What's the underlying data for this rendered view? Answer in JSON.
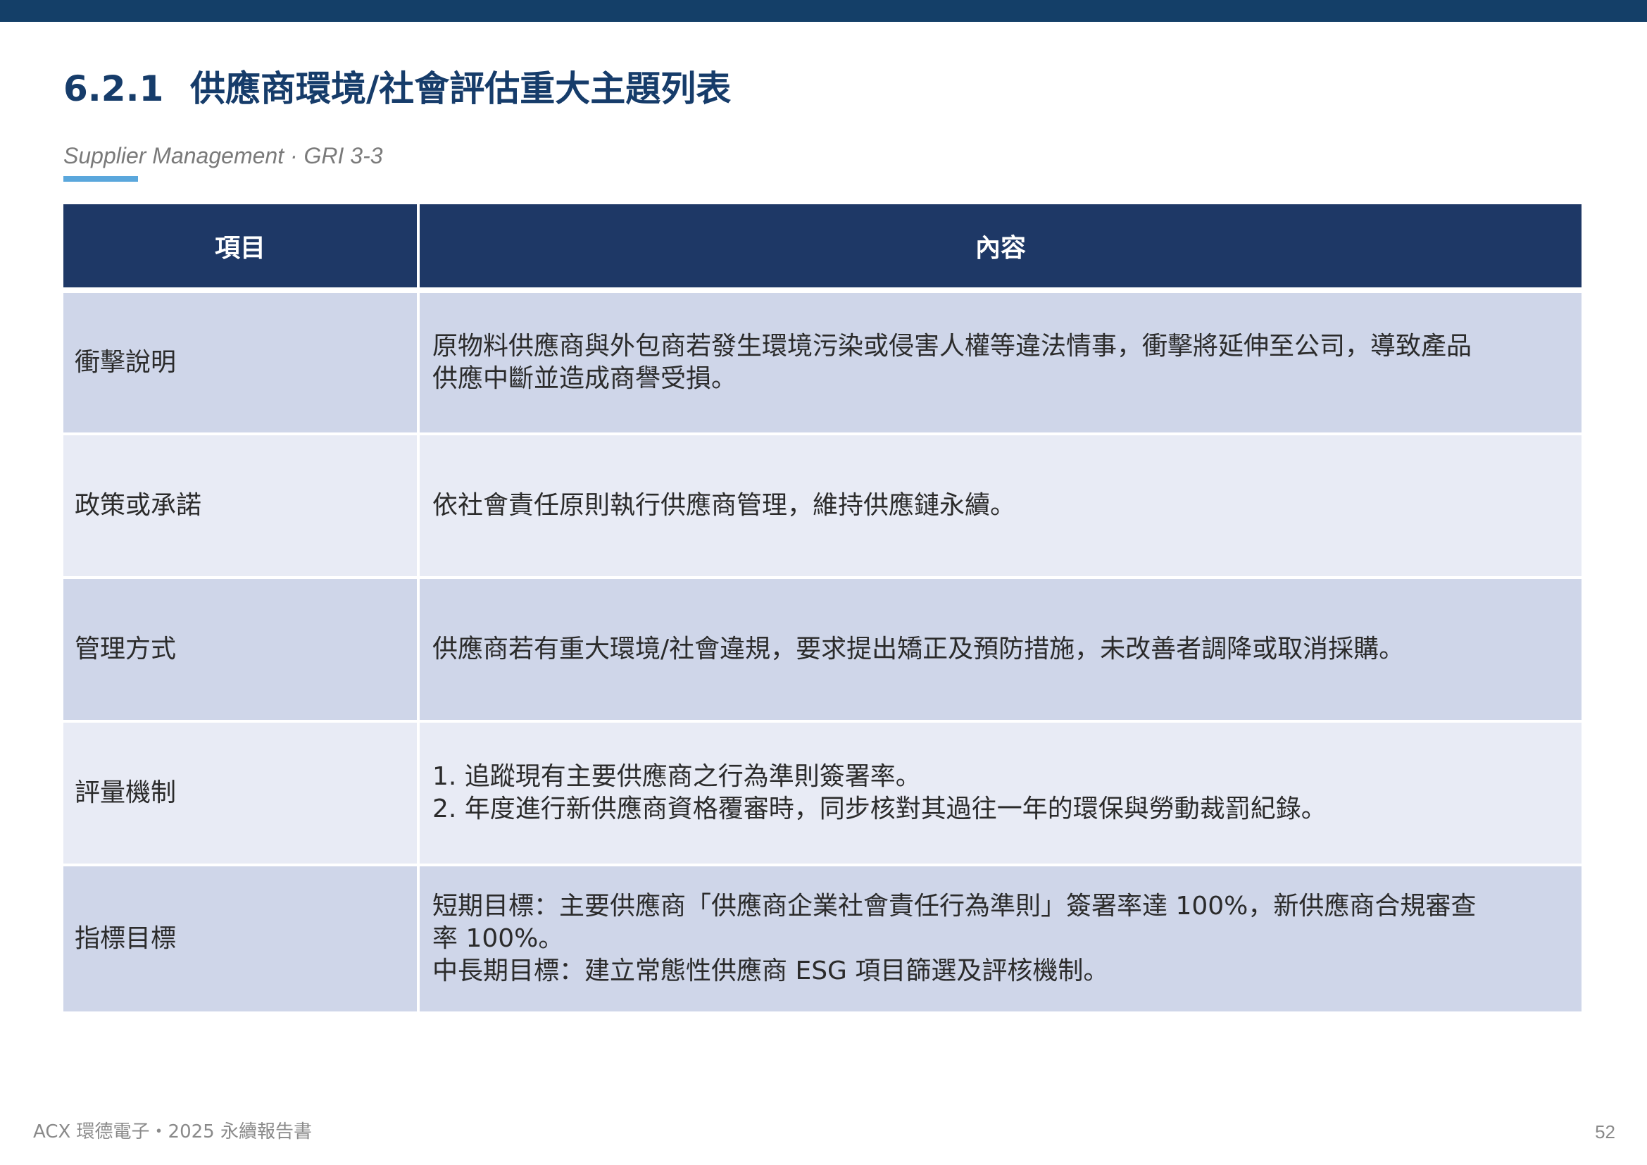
{
  "header": {
    "section_number": "6.2.1",
    "section_title": "供應商環境/社會評估重大主題列表",
    "subtitle": "Supplier Management · GRI 3-3"
  },
  "table": {
    "columns": [
      "項目",
      "內容"
    ],
    "rows": [
      {
        "item": "衝擊說明",
        "lines": [
          "原物料供應商與外包商若發生環境污染或侵害人權等違法情事，衝擊將延伸至公司，導致產品",
          "供應中斷並造成商譽受損。"
        ]
      },
      {
        "item": "政策或承諾",
        "lines": [
          "依社會責任原則執行供應商管理，維持供應鏈永續。"
        ]
      },
      {
        "item": "管理方式",
        "lines": [
          "供應商若有重大環境/社會違規，要求提出矯正及預防措施，未改善者調降或取消採購。"
        ]
      },
      {
        "item": "評量機制",
        "lines": [
          "1. 追蹤現有主要供應商之行為準則簽署率。",
          "2. 年度進行新供應商資格覆審時，同步核對其過往一年的環保與勞動裁罰紀錄。"
        ]
      },
      {
        "item": "指標目標",
        "lines": [
          "短期目標：主要供應商「供應商企業社會責任行為準則」簽署率達 100%，新供應商合規審查",
          "率 100%。",
          "中長期目標：建立常態性供應商 ESG 項目篩選及評核機制。"
        ]
      }
    ]
  },
  "footer": {
    "report_name": "ACX 環德電子・2025 永續報告書",
    "page_number": "52"
  },
  "colors": {
    "top_bar": "#143f68",
    "title": "#163c6a",
    "header_cell": "#1e3866",
    "row_dark": "#cfd6e9",
    "row_light": "#e8ebf5",
    "accent_underline": "#5aa7dc"
  }
}
